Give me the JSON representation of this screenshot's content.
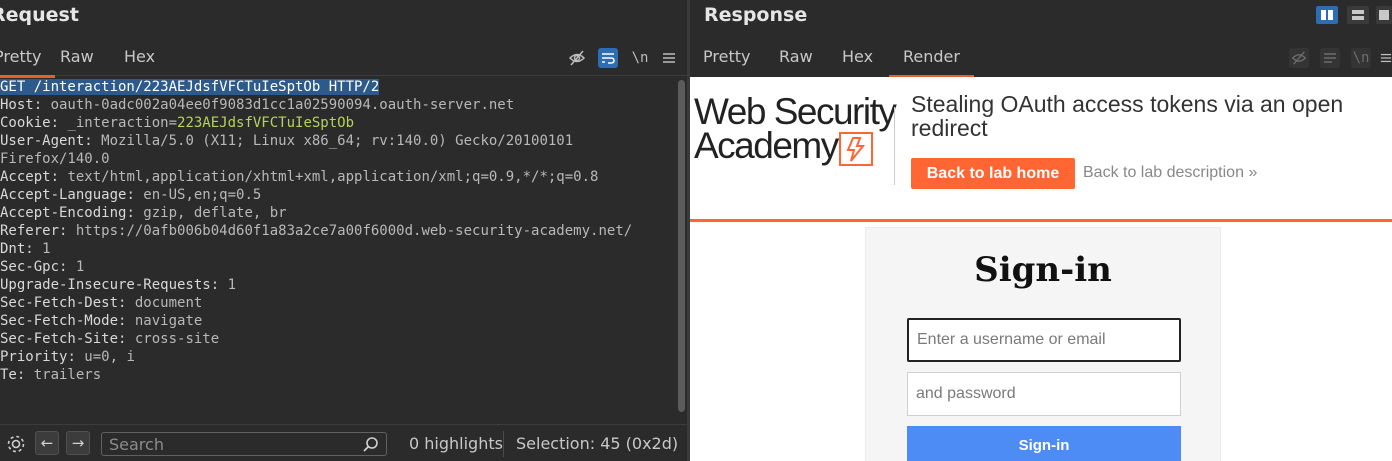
{
  "request": {
    "title": "Request",
    "tabs": [
      "Pretty",
      "Raw",
      "Hex"
    ],
    "active_tab": "Pretty",
    "toolbar_icons": [
      "eye-off-icon",
      "wrap-icon",
      "newline-icon",
      "menu-icon"
    ],
    "newline_label": "\\n",
    "request_line": "GET /interaction/223AEJdsfVFCTuIeSptOb HTTP/2",
    "headers": [
      {
        "key": "Host",
        "value": "oauth-0adc002a04ee0f9083d1cc1a02590094.oauth-server.net"
      },
      {
        "key": "Cookie",
        "value_prefix": "_interaction=",
        "value_highlight": "223AEJdsfVFCTuIeSptOb"
      },
      {
        "key": "User-Agent",
        "value": "Mozilla/5.0 (X11; Linux x86_64; rv:140.0) Gecko/20100101",
        "continuation": "Firefox/140.0"
      },
      {
        "key": "Accept",
        "value": "text/html,application/xhtml+xml,application/xml;q=0.9,*/*;q=0.8"
      },
      {
        "key": "Accept-Language",
        "value": "en-US,en;q=0.5"
      },
      {
        "key": "Accept-Encoding",
        "value": "gzip, deflate, br"
      },
      {
        "key": "Referer",
        "value": "https://0afb006b04d60f1a83a2ce7a00f6000d.web-security-academy.net/"
      },
      {
        "key": "Dnt",
        "value": "1"
      },
      {
        "key": "Sec-Gpc",
        "value": "1"
      },
      {
        "key": "Upgrade-Insecure-Requests",
        "value": "1"
      },
      {
        "key": "Sec-Fetch-Dest",
        "value": "document"
      },
      {
        "key": "Sec-Fetch-Mode",
        "value": "navigate"
      },
      {
        "key": "Sec-Fetch-Site",
        "value": "cross-site"
      },
      {
        "key": "Priority",
        "value": "u=0, i"
      },
      {
        "key": "Te",
        "value": "trailers"
      }
    ],
    "search_placeholder": "Search",
    "highlights": "0 highlights",
    "selection": "Selection: 45 (0x2d)"
  },
  "response": {
    "title": "Response",
    "tabs": [
      "Pretty",
      "Raw",
      "Hex",
      "Render"
    ],
    "active_tab": "Render",
    "render": {
      "logo_line1": "Web Security",
      "logo_line2": "Academy",
      "lab_title": "Stealing OAuth access tokens via an open redirect",
      "back_home_label": "Back to lab home",
      "back_desc_label": "Back to lab description",
      "back_desc_icon": "»",
      "signin_heading": "Sign-in",
      "username_placeholder": "Enter a username or email",
      "password_placeholder": "and password",
      "signin_button": "Sign-in"
    }
  },
  "colors": {
    "accent": "#e4602f",
    "academy_orange": "#ff6633",
    "signin_blue": "#4d8cf5",
    "selection_bg": "#2d5a8a",
    "cookie_highlight": "#b5d35a"
  }
}
